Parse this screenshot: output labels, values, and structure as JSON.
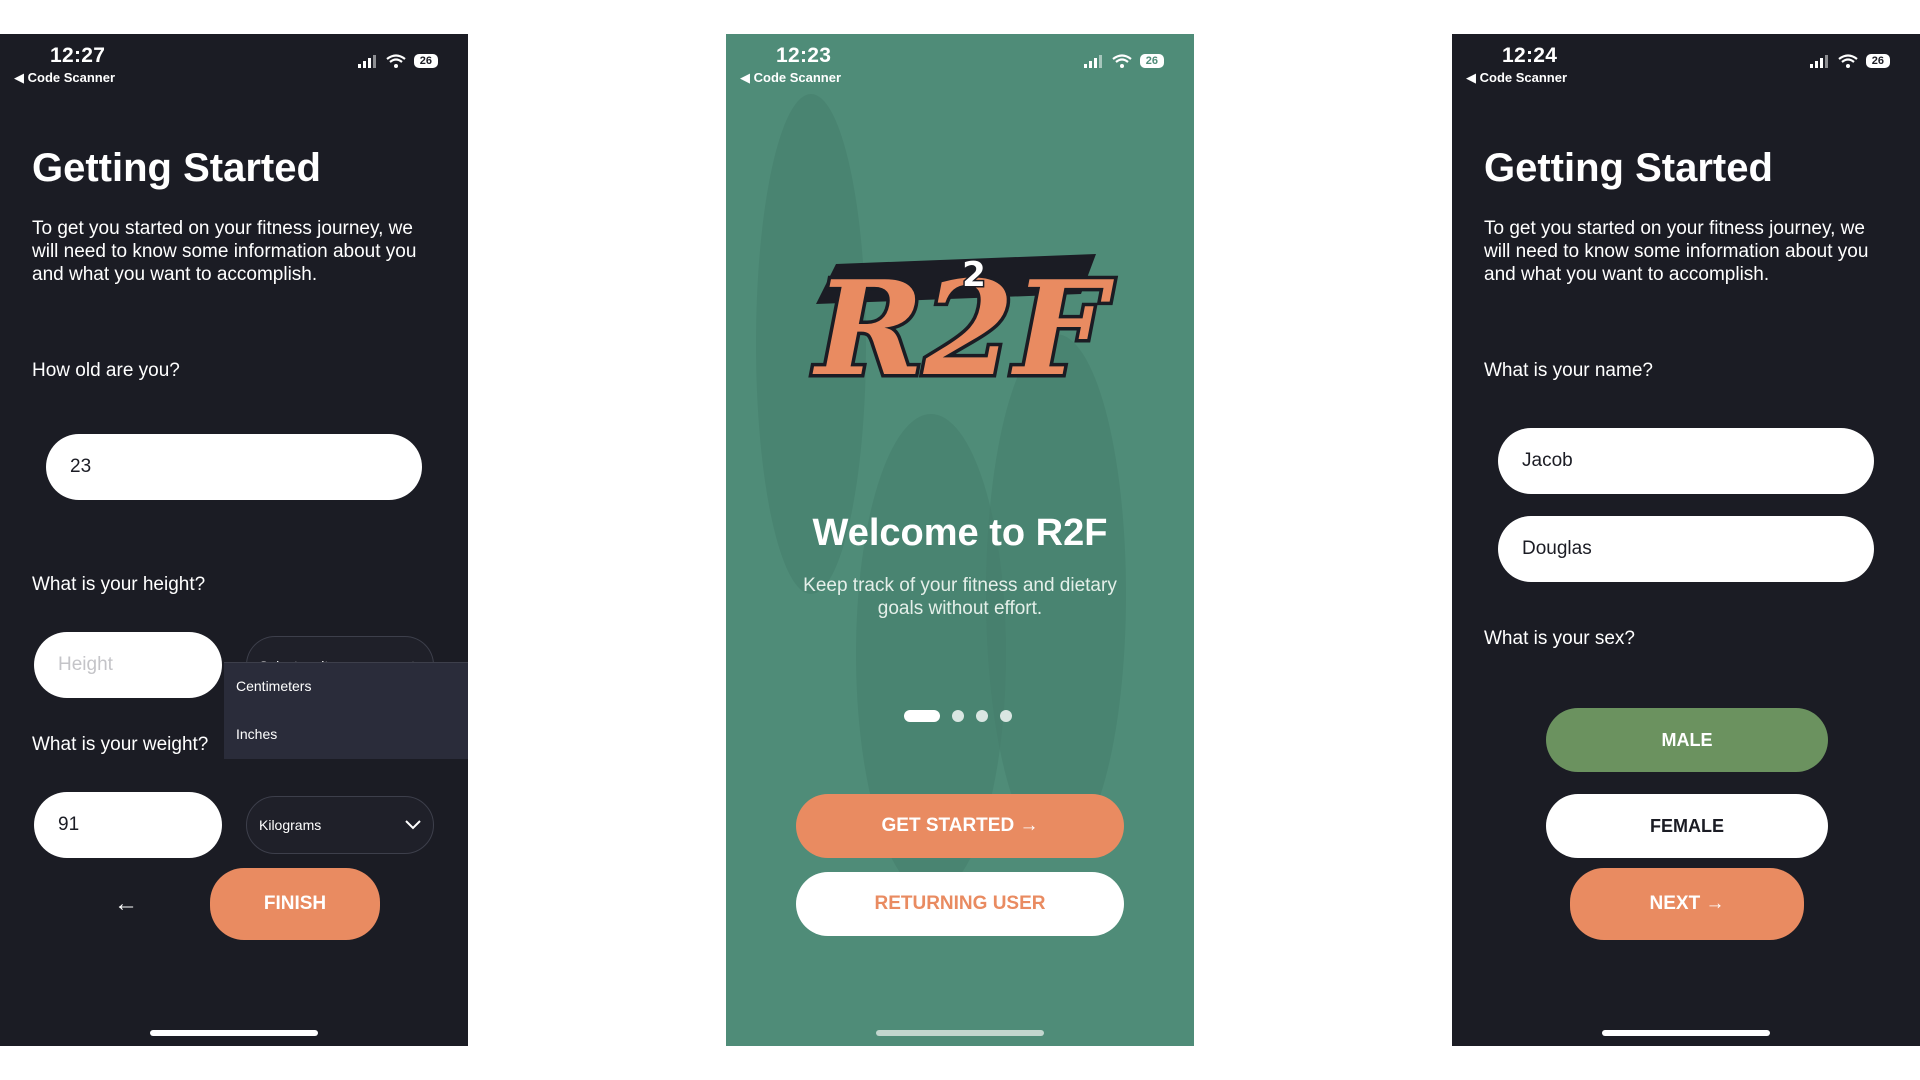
{
  "status_bars": [
    {
      "time": "12:27",
      "back_label": "◀ Code Scanner",
      "battery": "26"
    },
    {
      "time": "12:23",
      "back_label": "◀ Code Scanner",
      "battery": "26"
    },
    {
      "time": "12:24",
      "back_label": "◀ Code Scanner",
      "battery": "26"
    }
  ],
  "screen_left": {
    "title": "Getting Started",
    "intro": "To get you started on your fitness journey, we will need to know some information about you and what you want to accomplish.",
    "age_question": "How old are you?",
    "age_value": "23",
    "height_question": "What is your height?",
    "height_placeholder": "Height",
    "height_unit_placeholder": "Select an item",
    "height_unit_options": [
      "Centimeters",
      "Inches"
    ],
    "weight_question": "What is your weight?",
    "weight_value": "91",
    "weight_unit": "Kilograms",
    "back_arrow": "←",
    "finish_label": "FINISH"
  },
  "screen_middle": {
    "logo_text": "R2F",
    "logo_superscript": "2",
    "welcome_title": "Welcome to R2F",
    "subtitle": "Keep track of your fitness and dietary goals without effort.",
    "carousel": {
      "count": 4,
      "active": 0
    },
    "get_started_label": "GET STARTED →",
    "returning_label": "RETURNING USER"
  },
  "screen_right": {
    "title": "Getting Started",
    "intro": "To get you started on your fitness journey, we will need to know some information about you and what you want to accomplish.",
    "name_question": "What is your name?",
    "first_name": "Jacob",
    "last_name": "Douglas",
    "sex_question": "What is your sex?",
    "male_label": "MALE",
    "female_label": "FEMALE",
    "next_label": "NEXT →"
  },
  "colors": {
    "dark_bg": "#1b1c24",
    "green_bg": "#4f8c78",
    "accent_orange": "#e98b61",
    "male_selected": "#6b925f"
  },
  "icons": [
    "signal-icon",
    "wifi-icon",
    "chevron-up-icon",
    "chevron-down-icon",
    "arrow-left-icon"
  ]
}
